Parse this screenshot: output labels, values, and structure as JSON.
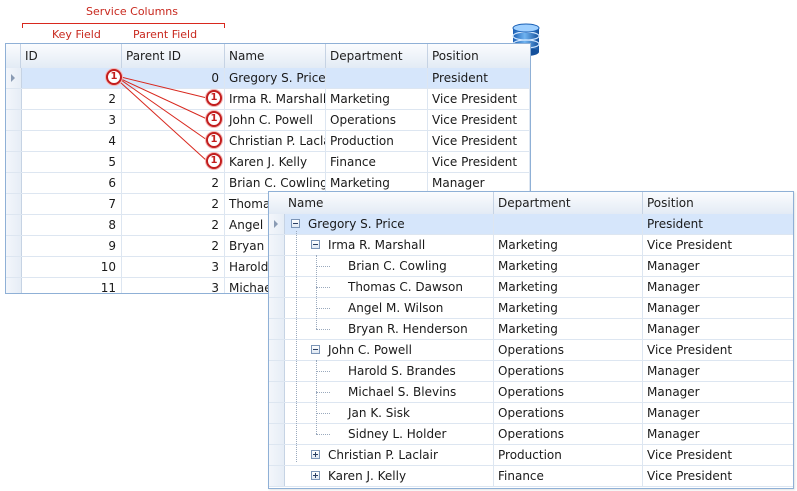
{
  "annotations": {
    "service_columns": "Service Columns",
    "key_field": "Key Field",
    "parent_field": "Parent Field",
    "accent_color": "#d8281e"
  },
  "badge_label": "1",
  "database_icon": "database-icon",
  "flat_grid": {
    "columns": [
      "ID",
      "Parent ID",
      "Name",
      "Department",
      "Position"
    ],
    "rows": [
      {
        "id": "1",
        "parent": "0",
        "name": "Gregory S. Price",
        "dept": "",
        "pos": "President"
      },
      {
        "id": "2",
        "parent": "1",
        "name": "Irma R. Marshall",
        "dept": "Marketing",
        "pos": "Vice President"
      },
      {
        "id": "3",
        "parent": "1",
        "name": "John C. Powell",
        "dept": "Operations",
        "pos": "Vice President"
      },
      {
        "id": "4",
        "parent": "1",
        "name": "Christian P. Laclair",
        "dept": "Production",
        "pos": "Vice President"
      },
      {
        "id": "5",
        "parent": "1",
        "name": "Karen J. Kelly",
        "dept": "Finance",
        "pos": "Vice President"
      },
      {
        "id": "6",
        "parent": "2",
        "name": "Brian C. Cowling",
        "dept": "Marketing",
        "pos": "Manager"
      },
      {
        "id": "7",
        "parent": "2",
        "name": "Thomas",
        "dept": "",
        "pos": ""
      },
      {
        "id": "8",
        "parent": "2",
        "name": "Angel M",
        "dept": "",
        "pos": ""
      },
      {
        "id": "9",
        "parent": "2",
        "name": "Bryan R",
        "dept": "",
        "pos": ""
      },
      {
        "id": "10",
        "parent": "3",
        "name": "Harold",
        "dept": "",
        "pos": ""
      },
      {
        "id": "11",
        "parent": "3",
        "name": "Michae",
        "dept": "",
        "pos": ""
      }
    ]
  },
  "tree_list": {
    "columns": [
      "Name",
      "Department",
      "Position"
    ],
    "rows": [
      {
        "name": "Gregory S. Price",
        "dept": "",
        "pos": "President"
      },
      {
        "name": "Irma R. Marshall",
        "dept": "Marketing",
        "pos": "Vice President"
      },
      {
        "name": "Brian C. Cowling",
        "dept": "Marketing",
        "pos": "Manager"
      },
      {
        "name": "Thomas C. Dawson",
        "dept": "Marketing",
        "pos": "Manager"
      },
      {
        "name": "Angel M. Wilson",
        "dept": "Marketing",
        "pos": "Manager"
      },
      {
        "name": "Bryan R. Henderson",
        "dept": "Marketing",
        "pos": "Manager"
      },
      {
        "name": "John C. Powell",
        "dept": "Operations",
        "pos": "Vice President"
      },
      {
        "name": "Harold S. Brandes",
        "dept": "Operations",
        "pos": "Manager"
      },
      {
        "name": "Michael S. Blevins",
        "dept": "Operations",
        "pos": "Manager"
      },
      {
        "name": "Jan K. Sisk",
        "dept": "Operations",
        "pos": "Manager"
      },
      {
        "name": "Sidney L. Holder",
        "dept": "Operations",
        "pos": "Manager"
      },
      {
        "name": "Christian P. Laclair",
        "dept": "Production",
        "pos": "Vice President"
      },
      {
        "name": "Karen J. Kelly",
        "dept": "Finance",
        "pos": "Vice President"
      }
    ]
  }
}
